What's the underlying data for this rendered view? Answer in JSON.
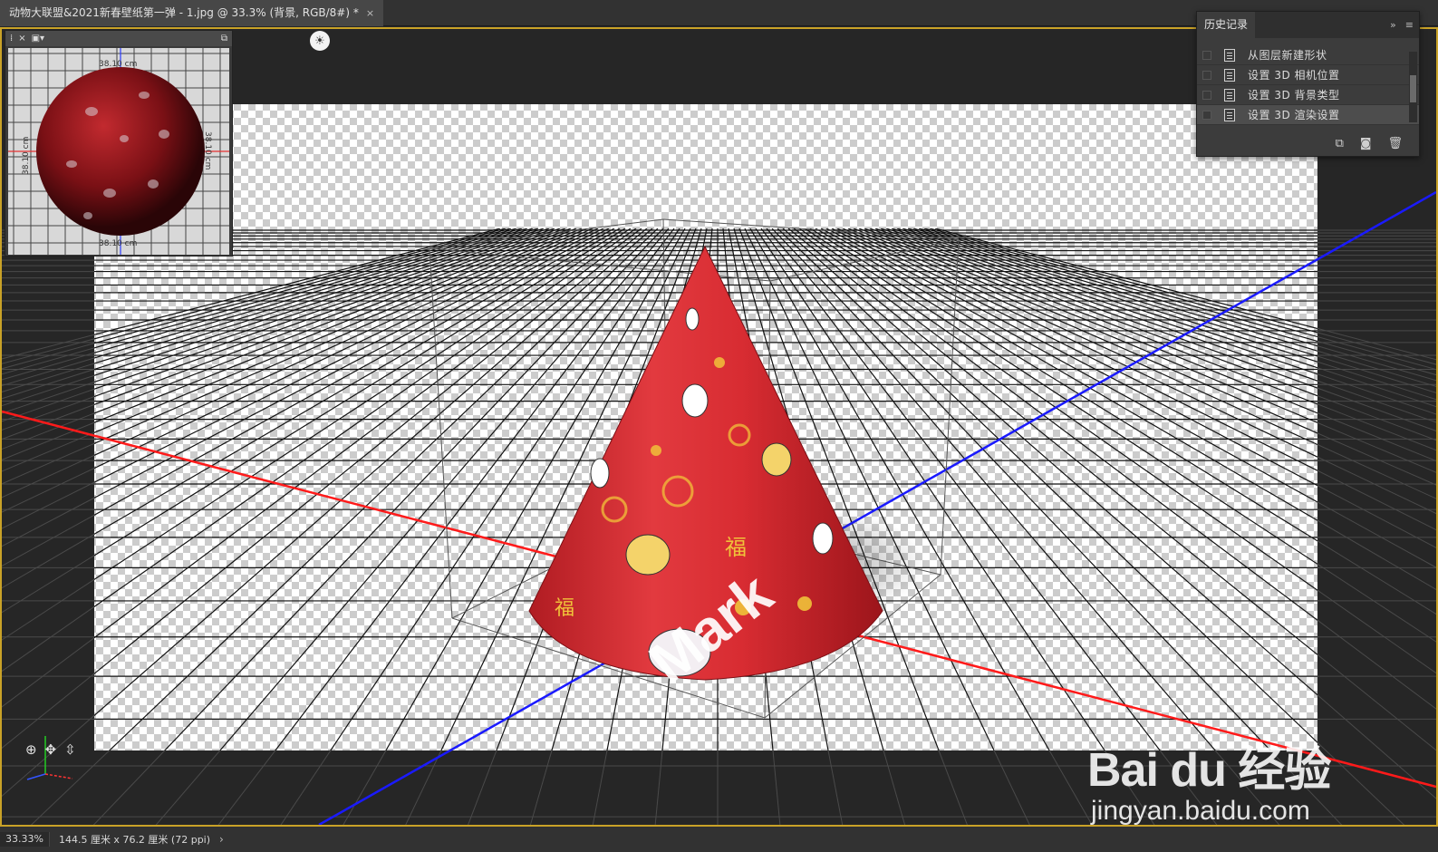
{
  "document": {
    "tab_title": "动物大联盟&2021新春壁纸第一弹 - 1.jpg @ 33.3% (背景, RGB/8#) *",
    "close_glyph": "×"
  },
  "secondary_view": {
    "close_glyph": "×",
    "dimension_top": "38.10 cm",
    "dimension_bottom": "38.10 cm",
    "dimension_right": "38.10 cm",
    "dimension_left": "38.10 cm"
  },
  "history_panel": {
    "title": "历史记录",
    "collapse_glyph": "»",
    "menu_glyph": "≡",
    "items": [
      {
        "label": "从图层新建形状",
        "selected": false
      },
      {
        "label": "设置 3D 相机位置",
        "selected": false
      },
      {
        "label": "设置 3D 背景类型",
        "selected": false
      },
      {
        "label": "设置 3D 渲染设置",
        "selected": true
      }
    ],
    "footer_icons": [
      "new-document-from-state-icon",
      "camera-snapshot-icon",
      "trash-icon"
    ]
  },
  "scene": {
    "cone_text": "Mark",
    "fu_char": "福",
    "axis_colors": {
      "x": "#ff1a1a",
      "z": "#1a1aff",
      "y": "#22cc22"
    },
    "cone_color": "#d42a30",
    "icons": [
      "rotate-camera-icon",
      "pan-camera-icon",
      "dolly-camera-icon",
      "light-bulb-icon"
    ]
  },
  "status_bar": {
    "zoom": "33.33%",
    "doc_size": "144.5 厘米 x 76.2 厘米 (72 ppi)",
    "arrow": "›"
  },
  "watermark": {
    "logo": "Bai du 经验",
    "url": "jingyan.baidu.com"
  }
}
